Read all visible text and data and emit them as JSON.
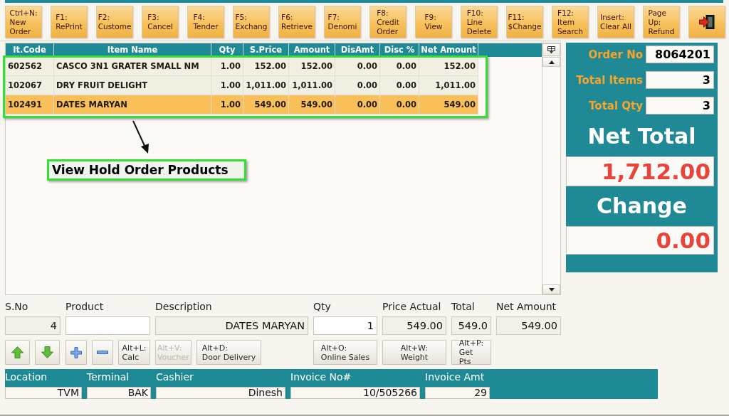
{
  "toolbar": {
    "buttons": [
      {
        "kind": "text",
        "lines": [
          "Ctrl+N:",
          "New",
          "Order"
        ]
      },
      {
        "kind": "text",
        "lines": [
          "F1:",
          "RePrint"
        ]
      },
      {
        "kind": "text",
        "lines": [
          "F2:",
          "Custome"
        ]
      },
      {
        "kind": "text",
        "lines": [
          "F3:",
          "Cancel"
        ]
      },
      {
        "kind": "text",
        "lines": [
          "F4:",
          "Tender"
        ]
      },
      {
        "kind": "text",
        "lines": [
          "F5:",
          "Exchang"
        ]
      },
      {
        "kind": "text",
        "lines": [
          "F6:",
          "Retrieve"
        ]
      },
      {
        "kind": "text",
        "lines": [
          "F7:",
          "Denomi"
        ]
      },
      {
        "kind": "text",
        "lines": [
          "F8:",
          "Credit",
          "Order"
        ]
      },
      {
        "kind": "text",
        "lines": [
          "F9:",
          "View"
        ]
      },
      {
        "kind": "text",
        "lines": [
          "F10:",
          "Line",
          "Delete"
        ]
      },
      {
        "kind": "text",
        "lines": [
          "F11:",
          "$Change"
        ]
      },
      {
        "kind": "text",
        "lines": [
          "F12:",
          "Item",
          "Search"
        ]
      },
      {
        "kind": "text",
        "lines": [
          "Insert:",
          "Clear All"
        ]
      },
      {
        "kind": "text",
        "lines": [
          "Page",
          "Up:",
          "Refund"
        ]
      },
      {
        "kind": "exit"
      }
    ]
  },
  "table": {
    "columns": [
      "It.Code",
      "Item Name",
      "Qty",
      "S.Price",
      "Amount",
      "DisAmt",
      "Disc %",
      "Net Amount"
    ],
    "rows": [
      {
        "selected": false,
        "cells": [
          "602562",
          "CASCO 3N1 GRATER SMALL NM",
          "1.00",
          "152.00",
          "152.00",
          "0.00",
          "0.00",
          "152.00"
        ]
      },
      {
        "selected": false,
        "cells": [
          "102067",
          "DRY FRUIT DELIGHT",
          "1.00",
          "1,011.00",
          "1,011.00",
          "0.00",
          "0.00",
          "1,011.00"
        ]
      },
      {
        "selected": true,
        "cells": [
          "102491",
          "DATES MARYAN",
          "1.00",
          "549.00",
          "549.00",
          "0.00",
          "0.00",
          "549.00"
        ]
      }
    ]
  },
  "annotation": {
    "label": "View Hold Order Products"
  },
  "summary": {
    "fields": [
      {
        "label": "Order No",
        "value": "8064201"
      },
      {
        "label": "Total Items",
        "value": "3"
      },
      {
        "label": "Total Qty",
        "value": "3"
      }
    ],
    "totals": [
      {
        "label": "Net Total",
        "value": "1,712.00"
      },
      {
        "label": "Change",
        "value": "0.00"
      }
    ]
  },
  "entry": {
    "columns": [
      "S.No",
      "Product",
      "Description",
      "Qty",
      "Price Actual",
      "Total",
      "Net Amount"
    ],
    "cells": [
      {
        "text": "4",
        "readonly": true
      },
      {
        "readonly": false
      },
      {
        "text": "DATES MARYAN",
        "readonly": true
      },
      {
        "text": "1",
        "readonly": false
      },
      {
        "text": "549.00",
        "readonly": true
      },
      {
        "text": "549.0",
        "readonly": true
      },
      {
        "text": "549.00",
        "readonly": true
      }
    ],
    "action_groups": [
      [
        {
          "kind": "up"
        },
        {
          "kind": "down"
        }
      ],
      [
        {
          "kind": "plus"
        },
        {
          "kind": "minus"
        },
        {
          "kind": "text",
          "lines": [
            "Alt+L:",
            "Calc"
          ],
          "disabled": false
        }
      ],
      [
        {
          "kind": "text",
          "lines": [
            "Alt+V:",
            "Voucher"
          ],
          "disabled": true
        },
        {
          "kind": "text",
          "lines": [
            "Alt+D:",
            "Door Delivery"
          ],
          "disabled": false
        }
      ],
      [
        {
          "kind": "text",
          "lines": [
            "Alt+O:",
            "Online Sales"
          ],
          "disabled": false
        }
      ],
      [
        {
          "kind": "text",
          "lines": [
            "Alt+W:",
            "Weight"
          ],
          "disabled": false
        }
      ],
      [
        {
          "kind": "text",
          "lines": [
            "Alt+P:",
            "Get",
            "Pts"
          ],
          "disabled": false
        }
      ]
    ]
  },
  "status_bar": {
    "columns": [
      "Location",
      "Terminal",
      "Cashier",
      "Invoice No#",
      "Invoice Amt"
    ],
    "cells": [
      "TVM",
      "BAK",
      "Dinesh",
      "10/505266",
      "29"
    ]
  }
}
